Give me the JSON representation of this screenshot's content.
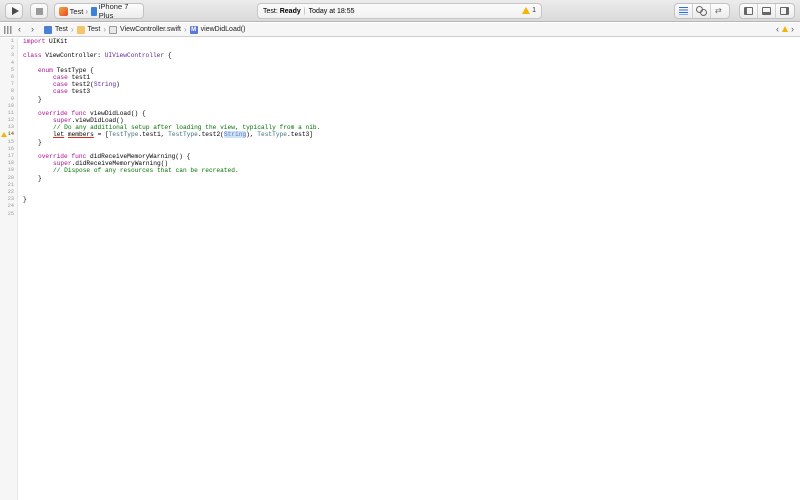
{
  "toolbar": {
    "scheme": {
      "target": "Test",
      "device": "iPhone 7 Plus"
    },
    "status": {
      "activity_prefix": "Test: ",
      "activity_state": "Ready",
      "time": "Today at 18:55",
      "warning_count": "1"
    }
  },
  "jumpbar": {
    "crumbs": [
      "Test",
      "Test",
      "ViewController.swift",
      "viewDidLoad()"
    ],
    "method_badge": "M"
  },
  "editor": {
    "line_numbers": [
      "1",
      "2",
      "3",
      "4",
      "5",
      "6",
      "7",
      "8",
      "9",
      "10",
      "11",
      "12",
      "13",
      "14",
      "15",
      "16",
      "17",
      "18",
      "19",
      "20",
      "21",
      "22",
      "23",
      "24",
      "25"
    ],
    "warning_line": "14"
  },
  "code": {
    "l1": {
      "kw": "import",
      "rest": " UIKit"
    },
    "l3": {
      "kw": "class",
      "name": " ViewController: ",
      "super": "UIViewController",
      "tail": " {"
    },
    "l5": {
      "kw": "enum",
      "rest": " TestType {"
    },
    "l6": {
      "kw": "case",
      "rest": " test1"
    },
    "l7": {
      "kw": "case",
      "rest": " test2(",
      "type": "String",
      "tail": ")"
    },
    "l8": {
      "kw": "case",
      "rest": " test3"
    },
    "l9": "}",
    "l11": {
      "kw": "override func",
      "rest": " viewDidLoad() {"
    },
    "l12": {
      "kw": "super",
      "rest": ".viewDidLoad()"
    },
    "l13": "// Do any additional setup after loading the view, typically from a nib.",
    "l14": {
      "kw": "let",
      "name": "members",
      "eq": " = [",
      "t1": "TestType",
      "v1": ".test1, ",
      "t2": "TestType",
      "v2": ".test2(",
      "placeholder": "String",
      "v3": "), ",
      "t3": "TestType",
      "v4": ".test3]"
    },
    "l15": "}",
    "l17": {
      "kw": "override func",
      "rest": " didReceiveMemoryWarning() {"
    },
    "l18": {
      "kw": "super",
      "rest": ".didReceiveMemoryWarning()"
    },
    "l19": "// Dispose of any resources that can be recreated.",
    "l20": "}",
    "l23": "}"
  }
}
